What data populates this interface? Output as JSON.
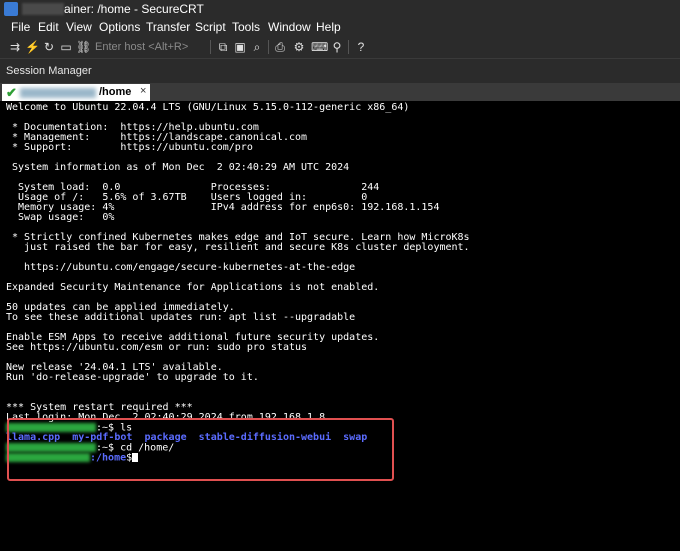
{
  "window": {
    "title": "ainer: /home - SecureCRT"
  },
  "menu": [
    "File",
    "Edit",
    "View",
    "Options",
    "Transfer",
    "Script",
    "Tools",
    "Window",
    "Help"
  ],
  "toolbar": {
    "host_placeholder": "Enter host <Alt+R>"
  },
  "session_manager": {
    "label": "Session Manager"
  },
  "tab": {
    "label": "/home",
    "close": "×"
  },
  "terminal": {
    "lines": [
      "Welcome to Ubuntu 22.04.4 LTS (GNU/Linux 5.15.0-112-generic x86_64)",
      " * Documentation:  https://help.ubuntu.com",
      " * Management:     https://landscape.canonical.com",
      " * Support:        https://ubuntu.com/pro",
      " System information as of Mon Dec  2 02:40:29 AM UTC 2024",
      "  System load:  0.0               Processes:               244",
      "  Usage of /:   5.6% of 3.67TB    Users logged in:         0",
      "  Memory usage: 4%                IPv4 address for enp6s0: 192.168.1.154",
      "  Swap usage:   0%",
      " * Strictly confined Kubernetes makes edge and IoT secure. Learn how MicroK8s",
      "   just raised the bar for easy, resilient and secure K8s cluster deployment.",
      "   https://ubuntu.com/engage/secure-kubernetes-at-the-edge",
      "Expanded Security Maintenance for Applications is not enabled.",
      "50 updates can be applied immediately.",
      "To see these additional updates run: apt list --upgradable",
      "Enable ESM Apps to receive additional future security updates.",
      "See https://ubuntu.com/esm or run: sudo pro status",
      "New release '24.04.1 LTS' available.",
      "Run 'do-release-upgrade' to upgrade to it.",
      "*** System restart required ***",
      "Last login: Mon Dec  2 02:40:29 2024 from 192.168.1.8"
    ],
    "prompt1_cmd": ":~$ ls",
    "ls_output": "llama.cpp  my-pdf-bot  package  stable-diffusion-webui  swap",
    "prompt2_cmd": ":~$ cd /home/",
    "prompt3_path": ":/home",
    "prompt3_end": "$"
  }
}
